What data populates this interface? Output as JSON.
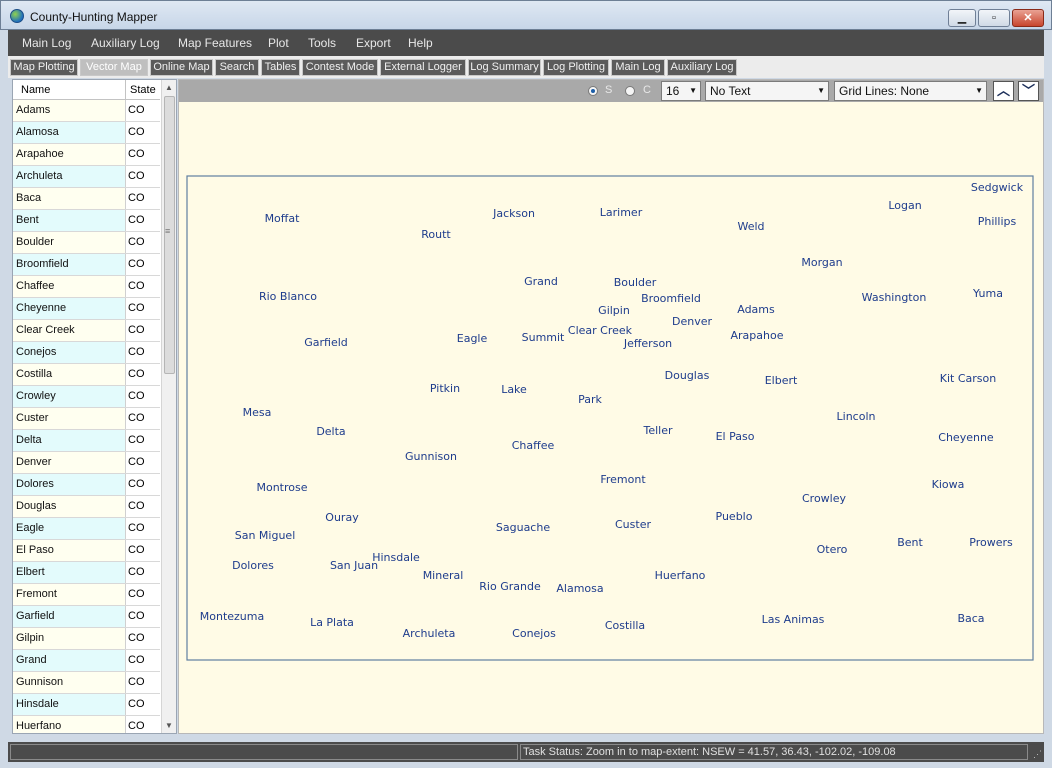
{
  "window": {
    "title": "County-Hunting Mapper",
    "min_icon": "minimize-icon",
    "max_icon": "maximize-icon",
    "close_icon": "close-icon"
  },
  "menu": [
    "Main Log",
    "Auxiliary Log",
    "Map Features",
    "Plot",
    "Tools",
    "Export",
    "Help"
  ],
  "tabs": [
    {
      "label": "Map Plotting"
    },
    {
      "label": "Vector Map",
      "active": true
    },
    {
      "label": "Online Map"
    },
    {
      "label": "Search"
    },
    {
      "label": "Tables"
    },
    {
      "label": "Contest Mode"
    },
    {
      "label": "External Logger"
    },
    {
      "label": "Log Summary"
    },
    {
      "label": "Log Plotting"
    },
    {
      "label": "Main Log"
    },
    {
      "label": "Auxiliary Log"
    }
  ],
  "county_list": {
    "headers": {
      "name": "Name",
      "state": "State"
    },
    "rows": [
      {
        "name": "Adams",
        "state": "CO"
      },
      {
        "name": "Alamosa",
        "state": "CO"
      },
      {
        "name": "Arapahoe",
        "state": "CO"
      },
      {
        "name": "Archuleta",
        "state": "CO"
      },
      {
        "name": "Baca",
        "state": "CO"
      },
      {
        "name": "Bent",
        "state": "CO"
      },
      {
        "name": "Boulder",
        "state": "CO"
      },
      {
        "name": "Broomfield",
        "state": "CO"
      },
      {
        "name": "Chaffee",
        "state": "CO"
      },
      {
        "name": "Cheyenne",
        "state": "CO"
      },
      {
        "name": "Clear Creek",
        "state": "CO"
      },
      {
        "name": "Conejos",
        "state": "CO"
      },
      {
        "name": "Costilla",
        "state": "CO"
      },
      {
        "name": "Crowley",
        "state": "CO"
      },
      {
        "name": "Custer",
        "state": "CO"
      },
      {
        "name": "Delta",
        "state": "CO"
      },
      {
        "name": "Denver",
        "state": "CO"
      },
      {
        "name": "Dolores",
        "state": "CO"
      },
      {
        "name": "Douglas",
        "state": "CO"
      },
      {
        "name": "Eagle",
        "state": "CO"
      },
      {
        "name": "El Paso",
        "state": "CO"
      },
      {
        "name": "Elbert",
        "state": "CO"
      },
      {
        "name": "Fremont",
        "state": "CO"
      },
      {
        "name": "Garfield",
        "state": "CO"
      },
      {
        "name": "Gilpin",
        "state": "CO"
      },
      {
        "name": "Grand",
        "state": "CO"
      },
      {
        "name": "Gunnison",
        "state": "CO"
      },
      {
        "name": "Hinsdale",
        "state": "CO"
      },
      {
        "name": "Huerfano",
        "state": "CO"
      }
    ]
  },
  "toolbar": {
    "radio_s": "S",
    "radio_c": "C",
    "radio_selected": "S",
    "size_value": "16",
    "text_mode": "No Text",
    "grid_lines": "Grid Lines: None",
    "up_icon": "arrow-up-icon",
    "down_icon": "arrow-down-icon"
  },
  "status": {
    "task": "Task Status: Zoom in to map-extent: NSEW = 41.57, 36.43, -102.02, -109.08"
  },
  "colors": {
    "cyan": "#14dfd0",
    "yellow": "#ede07a",
    "orange": "#e8a882",
    "pink": "#eca5a5",
    "green": "#8ee88e",
    "lavender": "#c5c2f0",
    "map_bg": "#fffbe6",
    "label": "#1e3c8c"
  },
  "counties": [
    {
      "name": "Moffat",
      "color": "cyan"
    },
    {
      "name": "Routt",
      "color": "yellow"
    },
    {
      "name": "Jackson",
      "color": "orange"
    },
    {
      "name": "Larimer",
      "color": "pink"
    },
    {
      "name": "Weld",
      "color": "yellow"
    },
    {
      "name": "Logan",
      "color": "green"
    },
    {
      "name": "Sedgwick",
      "color": "orange"
    },
    {
      "name": "Phillips",
      "color": "pink"
    },
    {
      "name": "Morgan",
      "color": "cyan"
    },
    {
      "name": "Washington",
      "color": "pink"
    },
    {
      "name": "Yuma",
      "color": "yellow"
    },
    {
      "name": "Rio Blanco",
      "color": "orange"
    },
    {
      "name": "Grand",
      "color": "green"
    },
    {
      "name": "Boulder",
      "color": "cyan"
    },
    {
      "name": "Broomfield",
      "color": "lavender"
    },
    {
      "name": "Adams",
      "color": "orange"
    },
    {
      "name": "Garfield",
      "color": "pink"
    },
    {
      "name": "Eagle",
      "color": "orange"
    },
    {
      "name": "Summit",
      "color": "lavender"
    },
    {
      "name": "Gilpin",
      "color": "yellow"
    },
    {
      "name": "Clear Creek",
      "color": "pink"
    },
    {
      "name": "Denver",
      "color": "cyan"
    },
    {
      "name": "Jefferson",
      "color": "green"
    },
    {
      "name": "Arapahoe",
      "color": "yellow"
    },
    {
      "name": "Mesa",
      "color": "orange"
    },
    {
      "name": "Pitkin",
      "color": "green"
    },
    {
      "name": "Lake",
      "color": "cyan"
    },
    {
      "name": "Park",
      "color": "yellow"
    },
    {
      "name": "Douglas",
      "color": "orange"
    },
    {
      "name": "Elbert",
      "color": "cyan"
    },
    {
      "name": "Lincoln",
      "color": "green"
    },
    {
      "name": "Kit Carson",
      "color": "orange"
    },
    {
      "name": "Delta",
      "color": "green"
    },
    {
      "name": "Gunnison",
      "color": "yellow"
    },
    {
      "name": "Chaffee",
      "color": "pink"
    },
    {
      "name": "Teller",
      "color": "cyan"
    },
    {
      "name": "El Paso",
      "color": "pink"
    },
    {
      "name": "Cheyenne",
      "color": "cyan"
    },
    {
      "name": "Montrose",
      "color": "pink"
    },
    {
      "name": "Fremont",
      "color": "orange"
    },
    {
      "name": "Kiowa",
      "color": "yellow"
    },
    {
      "name": "Ouray",
      "color": "orange"
    },
    {
      "name": "Saguache",
      "color": "green"
    },
    {
      "name": "Custer",
      "color": "cyan"
    },
    {
      "name": "Pueblo",
      "color": "yellow"
    },
    {
      "name": "Crowley",
      "color": "orange"
    },
    {
      "name": "San Miguel",
      "color": "yellow"
    },
    {
      "name": "Hinsdale",
      "color": "pink"
    },
    {
      "name": "Otero",
      "color": "pink"
    },
    {
      "name": "Bent",
      "color": "cyan"
    },
    {
      "name": "Prowers",
      "color": "orange"
    },
    {
      "name": "Dolores",
      "color": "pink"
    },
    {
      "name": "San Juan",
      "color": "green"
    },
    {
      "name": "Mineral",
      "color": "cyan"
    },
    {
      "name": "Rio Grande",
      "color": "orange"
    },
    {
      "name": "Alamosa",
      "color": "cyan"
    },
    {
      "name": "Huerfano",
      "color": "pink"
    },
    {
      "name": "Montezuma",
      "color": "orange"
    },
    {
      "name": "La Plata",
      "color": "cyan"
    },
    {
      "name": "Archuleta",
      "color": "yellow"
    },
    {
      "name": "Conejos",
      "color": "pink"
    },
    {
      "name": "Costilla",
      "color": "yellow"
    },
    {
      "name": "Las Animas",
      "color": "green"
    },
    {
      "name": "Baca",
      "color": "pink"
    }
  ]
}
